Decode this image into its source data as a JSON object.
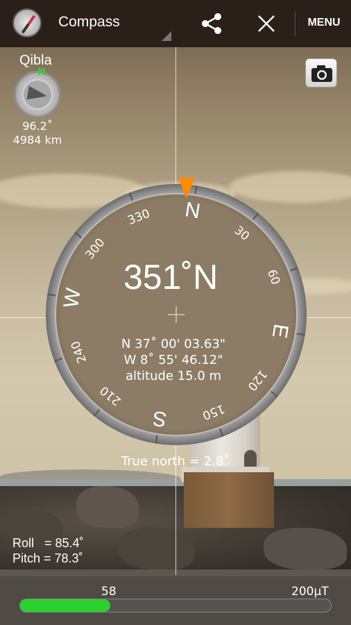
{
  "action_bar": {
    "title": "Compass",
    "menu_label": "MENU",
    "icons": [
      "compass-app-icon",
      "share-icon",
      "close-icon"
    ]
  },
  "qibla": {
    "label": "Qibla",
    "north_marker": "N",
    "bearing": "96.2˚",
    "distance": "4984 km"
  },
  "camera_button": {
    "icon": "camera-icon"
  },
  "compass": {
    "heading": "351˚N",
    "cardinals": [
      "N",
      "E",
      "S",
      "W"
    ],
    "tick_labels": [
      "30",
      "60",
      "120",
      "150",
      "210",
      "240",
      "300",
      "330"
    ],
    "latitude": "N 37˚ 00' 03.63\"",
    "longitude": "W 8˚ 55' 46.12\"",
    "altitude": "altitude 15.0 m",
    "true_north": "True north = 2.8˚",
    "marker_color": "#ff8a00"
  },
  "sensors": {
    "roll": "Roll   = 85.4˚",
    "pitch": "Pitch = 78.3˚"
  },
  "magnetic": {
    "value": "58",
    "max_label": "200µT",
    "fill_fraction": 0.29,
    "fill_color": "#2bd12e"
  }
}
